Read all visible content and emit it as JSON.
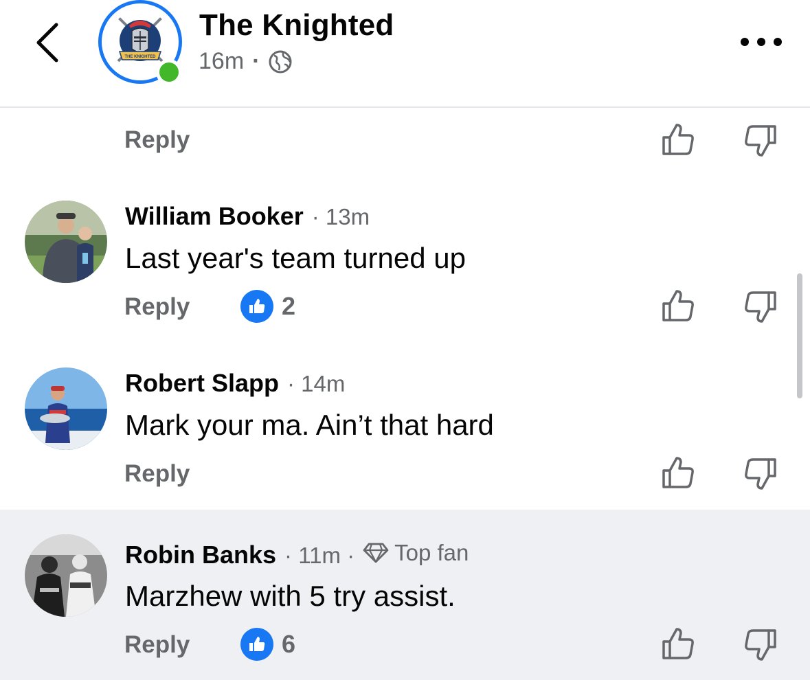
{
  "header": {
    "page_name": "The Knighted",
    "time": "16m",
    "separator": "·",
    "logo_text": "THE KNIGHTED",
    "privacy_icon": "globe-icon",
    "back_icon": "chevron-left-icon",
    "more_icon": "ellipsis-icon"
  },
  "top_reply": {
    "label": "Reply"
  },
  "comments": [
    {
      "name": "William Booker",
      "time": "· 13m",
      "text": "Last year's team turned up",
      "reply": "Reply",
      "reaction_count": "2"
    },
    {
      "name": "Robert Slapp",
      "time": "· 14m",
      "text": "Mark your ma. Ain’t that hard",
      "reply": "Reply"
    },
    {
      "name": "Robin Banks",
      "time": "· 11m ·",
      "badge": "Top fan",
      "text": "Marzhew with 5 try assist.",
      "reply": "Reply",
      "reaction_count": "6"
    }
  ],
  "colors": {
    "accent": "#1877f2",
    "online": "#42b72a",
    "muted": "#65676b",
    "highlight_bg": "#eef0f3"
  }
}
